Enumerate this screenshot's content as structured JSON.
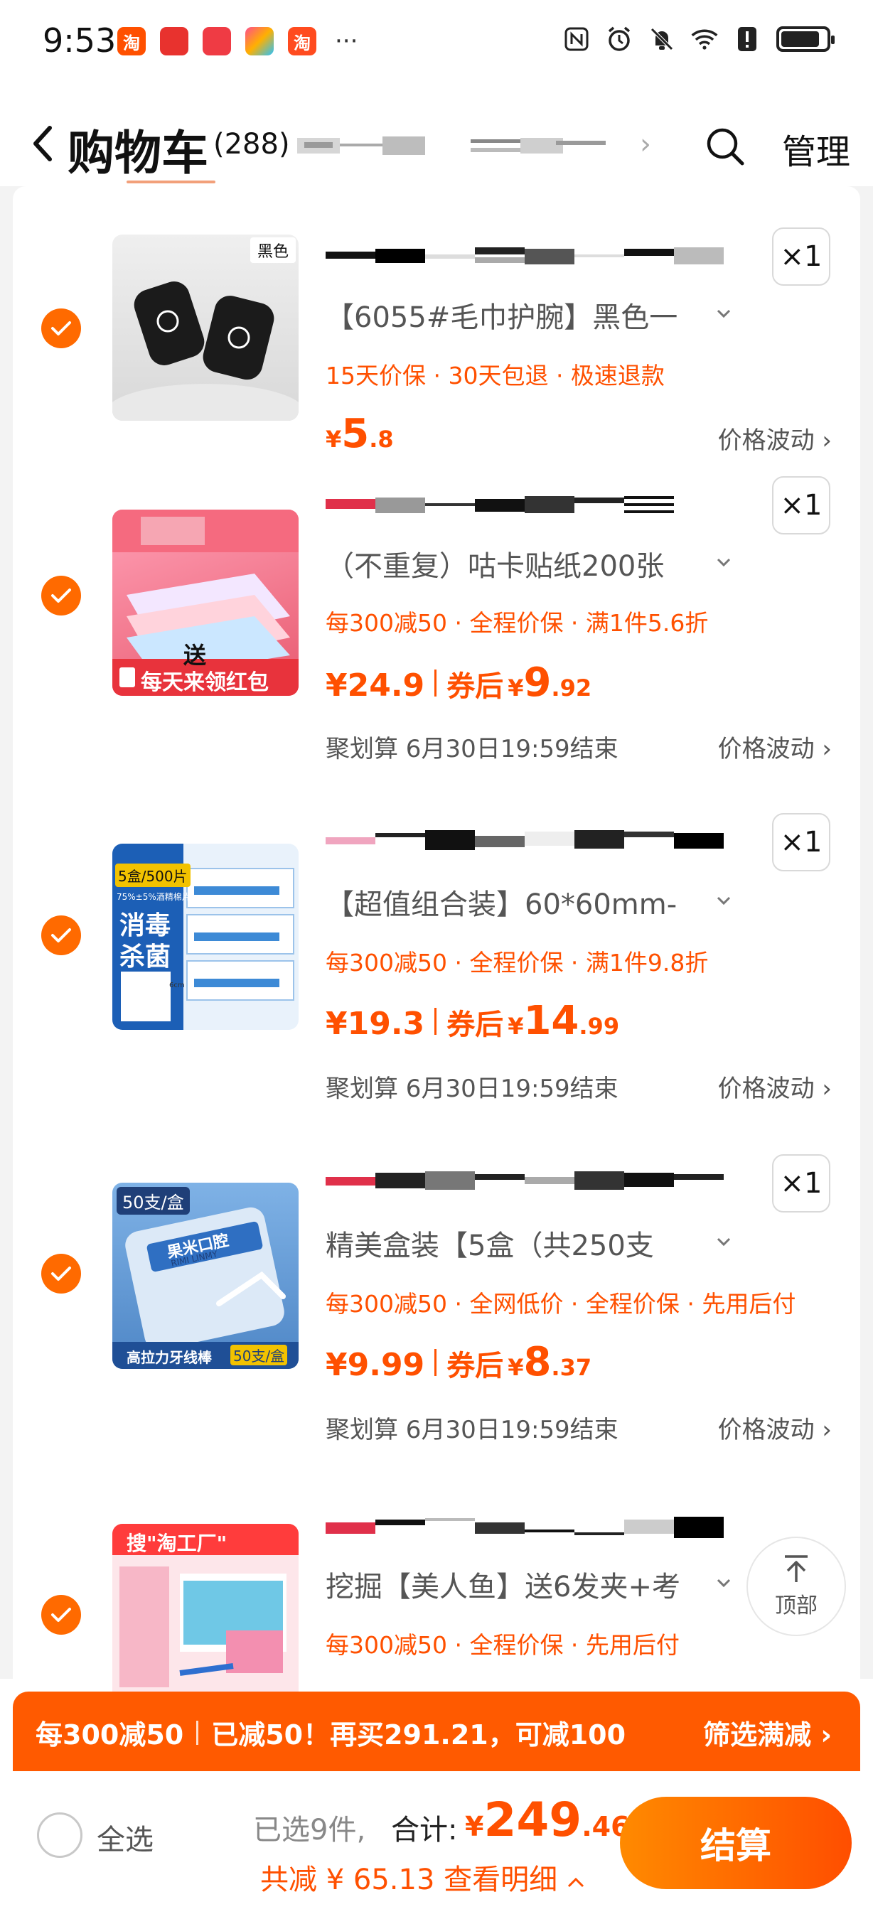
{
  "status_bar": {
    "time": "9:53",
    "apps": [
      {
        "icon": "taobao-app-icon",
        "glyph": "淘",
        "color": "#ff5000"
      },
      {
        "icon": "huawei-app-icon",
        "glyph": "",
        "color": "#e8322e"
      },
      {
        "icon": "red-app-icon",
        "glyph": "",
        "color": "#ef3b44"
      },
      {
        "icon": "colorful-app-icon",
        "glyph": "",
        "color": "#ffb000"
      },
      {
        "icon": "taobao-app-icon-2",
        "glyph": "淘",
        "color": "#ff4b1f"
      }
    ],
    "more": "···"
  },
  "header": {
    "title": "购物车",
    "count": "(288)",
    "manage": "管理"
  },
  "items": [
    {
      "sku": "【6055#毛巾护腕】黑色一",
      "promo": "15天价保 · 30天包退 · 极速退款",
      "price_big": "5",
      "price_small": ".8",
      "quantity": "×1",
      "fluctuation": "价格波动",
      "thumb_tag": "黑色"
    },
    {
      "sku": "（不重复）咕卡贴纸200张",
      "promo": "每300减50 · 全程价保 · 满1件5.6折",
      "price": "¥24.9",
      "coupon_label": "券后",
      "coupon_big": "9",
      "coupon_small": ".92",
      "quantity": "×1",
      "event": "聚划算 6月30日19:59结束",
      "fluctuation": "价格波动",
      "thumb_text_1": "送",
      "thumb_text_2": "每天来领红包"
    },
    {
      "sku": "【超值组合装】60*60mm-",
      "promo": "每300减50 · 全程价保 · 满1件9.8折",
      "price": "¥19.3",
      "coupon_label": "券后",
      "coupon_big": "14",
      "coupon_small": ".99",
      "quantity": "×1",
      "event": "聚划算 6月30日19:59结束",
      "fluctuation": "价格波动",
      "thumb_text_1": "5盒/500片",
      "thumb_text_2": "75%±5%酒精棉片",
      "thumb_text_3": "消毒",
      "thumb_text_4": "杀菌",
      "thumb_text_5": "6cm"
    },
    {
      "sku": "精美盒装【5盒（共250支",
      "promo": "每300减50 · 全网低价 · 全程价保 · 先用后付",
      "price": "¥9.99",
      "coupon_label": "券后",
      "coupon_big": "8",
      "coupon_small": ".37",
      "quantity": "×1",
      "event": "聚划算 6月30日19:59结束",
      "fluctuation": "价格波动",
      "thumb_text_1": "50支/盒",
      "thumb_text_2": "高拉力牙线棒",
      "thumb_text_3": "50支/盒",
      "thumb_text_4": "果米口腔",
      "thumb_text_5": "RIMI LINMY"
    },
    {
      "sku": "挖掘【美人鱼】送6发夹+考",
      "promo": "每300减50 · 全程价保 · 先用后付",
      "thumb_text_1": "搜\"淘工厂\""
    }
  ],
  "top_button": "顶部",
  "banner": {
    "left_1": "每300减50",
    "left_2": "已减50！再买291.21，可减100",
    "right": "筛选满减"
  },
  "bottom": {
    "select_all": "全选",
    "selected": "已选9件,",
    "total_label": "合计:",
    "total_yen": "¥",
    "total_big": "249",
    "total_small": ".46",
    "saved": "共减 ¥ 65.13 查看明细",
    "checkout": "结算"
  },
  "colors": {
    "accent": "#ff5000",
    "check": "#ff6a00",
    "banner": "#ff5a00"
  }
}
